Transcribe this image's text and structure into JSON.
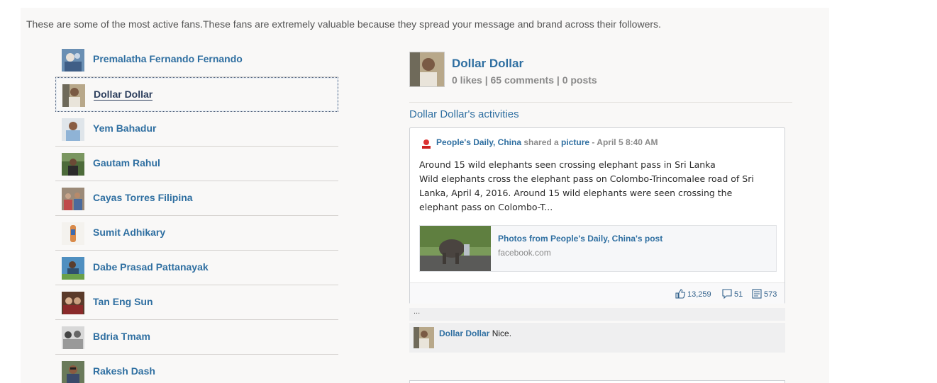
{
  "intro": "These are some of the most active fans.These fans are extremely valuable because they spread your message and brand across their followers.",
  "fans": [
    {
      "name": "Premalatha Fernando Fernando"
    },
    {
      "name": "Dollar Dollar"
    },
    {
      "name": "Yem Bahadur"
    },
    {
      "name": "Gautam Rahul"
    },
    {
      "name": "Cayas Torres Filipina"
    },
    {
      "name": "Sumit Adhikary"
    },
    {
      "name": "Dabe Prasad Pattanayak"
    },
    {
      "name": "Tan Eng Sun"
    },
    {
      "name": "Bdria Tmam"
    },
    {
      "name": "Rakesh Dash"
    }
  ],
  "profile": {
    "name": "Dollar Dollar",
    "stats": "0 likes | 65 comments | 0 posts"
  },
  "activities_title": "Dollar Dollar's activities",
  "post": {
    "source": "People's Daily, China",
    "action": "shared a",
    "object": "picture",
    "time": "- April 5 8:40 AM",
    "text": "Around 15 wild elephants seen crossing elephant pass in Sri Lanka\nWild elephants cross the elephant pass on Colombo-Trincomalee road of Sri Lanka, April 4, 2016. Around 15 wild elephants were seen crossing the elephant pass on Colombo-T...",
    "attachment_title": "Photos from People's Daily, China's post",
    "attachment_domain": "facebook.com",
    "likes": "13,259",
    "comments": "51",
    "shares": "573"
  },
  "ellipsis": "...",
  "comment": {
    "author": "Dollar Dollar",
    "text": " Nice."
  },
  "colors": {
    "link": "#2f6fa1",
    "panel": "#f9f8f7"
  }
}
